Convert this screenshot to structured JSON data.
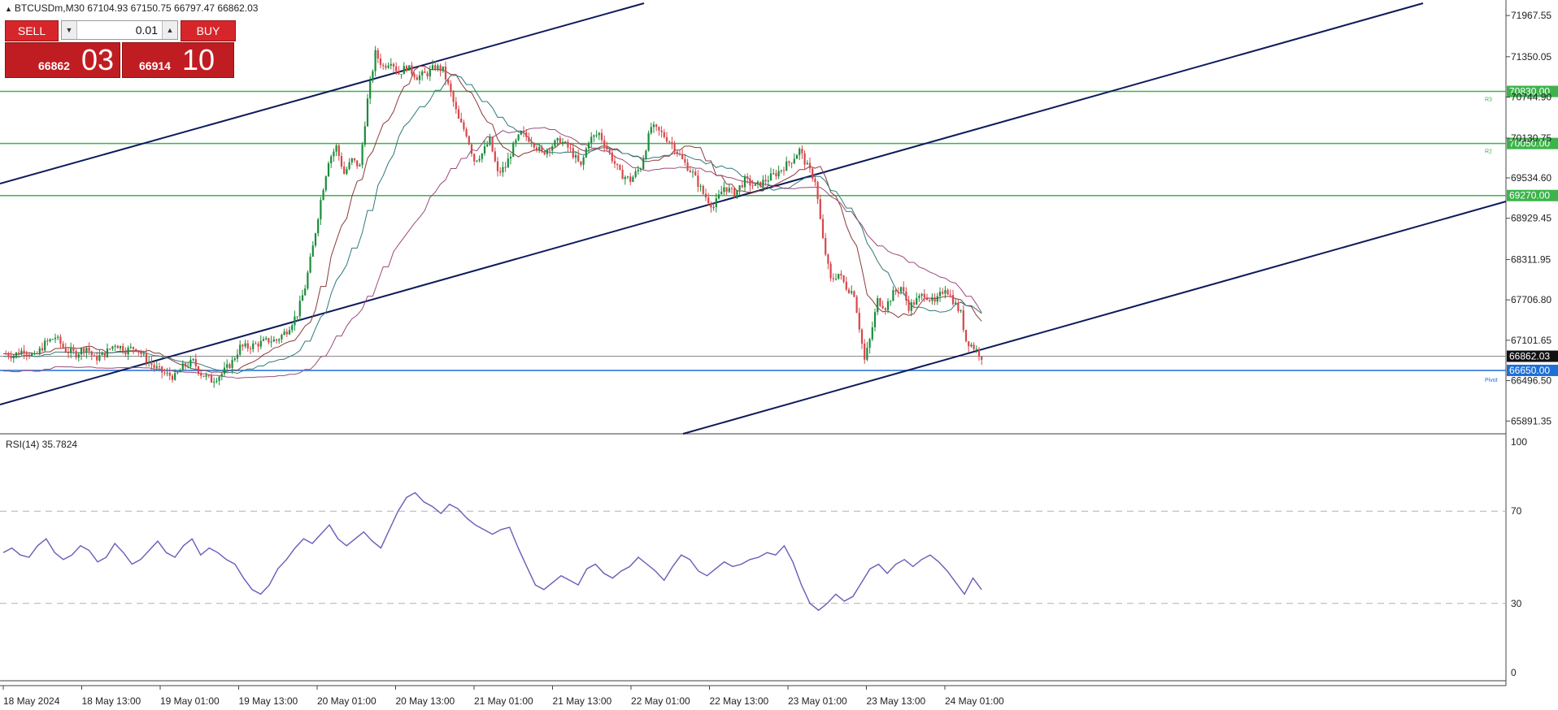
{
  "header": {
    "symbol_info": "BTCUSDm,M30  67104.93 67150.75 66797.47 66862.03"
  },
  "trade_panel": {
    "sell_label": "SELL",
    "buy_label": "BUY",
    "lot_value": "0.01",
    "sell_price_small": "66862",
    "sell_price_big": "03",
    "buy_price_small": "66914",
    "buy_price_big": "10"
  },
  "chart_data": {
    "type": "candlestick",
    "symbol": "BTCUSDm",
    "timeframe": "M30",
    "ohlc": {
      "open": 67104.93,
      "high": 67150.75,
      "low": 66797.47,
      "close": 66862.03
    },
    "price_axis_ticks": [
      "71967.55",
      "71350.05",
      "70744.90",
      "70130.75",
      "69534.60",
      "68929.45",
      "68311.95",
      "67706.80",
      "67101.65",
      "66496.50",
      "65891.35"
    ],
    "time_axis_ticks": [
      "18 May 2024",
      "18 May 13:00",
      "19 May 01:00",
      "19 May 13:00",
      "20 May 01:00",
      "20 May 13:00",
      "21 May 01:00",
      "21 May 13:00",
      "22 May 01:00",
      "22 May 13:00",
      "23 May 01:00",
      "23 May 13:00",
      "24 May 01:00"
    ],
    "current_price": "66862.03",
    "horizontal_levels": [
      {
        "label": "70830.00",
        "value": 70830.0,
        "color": "#3cb44b",
        "tag": "R3"
      },
      {
        "label": "70050.00",
        "value": 70050.0,
        "color": "#3cb44b",
        "tag": "R2"
      },
      {
        "label": "69270.00",
        "value": 69270.0,
        "color": "#3cb44b",
        "tag": ""
      },
      {
        "label": "66650.00",
        "value": 66650.0,
        "color": "#1e6fd6",
        "tag": "Pivot"
      }
    ],
    "price_path": [
      [
        0,
        66900
      ],
      [
        8,
        66880
      ],
      [
        16,
        66960
      ],
      [
        24,
        66850
      ],
      [
        32,
        67050
      ],
      [
        40,
        67150
      ],
      [
        48,
        66950
      ],
      [
        56,
        66900
      ],
      [
        64,
        67000
      ],
      [
        70,
        66820
      ],
      [
        78,
        66900
      ],
      [
        86,
        67050
      ],
      [
        94,
        66950
      ],
      [
        102,
        67000
      ],
      [
        108,
        66850
      ],
      [
        116,
        66700
      ],
      [
        124,
        66600
      ],
      [
        132,
        66550
      ],
      [
        138,
        66700
      ],
      [
        146,
        66780
      ],
      [
        152,
        66600
      ],
      [
        160,
        66500
      ],
      [
        168,
        66600
      ],
      [
        176,
        66780
      ],
      [
        182,
        67000
      ],
      [
        188,
        67000
      ],
      [
        196,
        67050
      ],
      [
        204,
        67100
      ],
      [
        210,
        67100
      ],
      [
        218,
        67250
      ],
      [
        226,
        67500
      ],
      [
        232,
        67900
      ],
      [
        238,
        68500
      ],
      [
        244,
        69200
      ],
      [
        250,
        69800
      ],
      [
        256,
        70000
      ],
      [
        262,
        69600
      ],
      [
        268,
        69800
      ],
      [
        274,
        69700
      ],
      [
        280,
        70700
      ],
      [
        286,
        71400
      ],
      [
        292,
        71200
      ],
      [
        298,
        71300
      ],
      [
        304,
        71100
      ],
      [
        310,
        71200
      ],
      [
        318,
        71050
      ],
      [
        326,
        71100
      ],
      [
        332,
        71200
      ],
      [
        338,
        71150
      ],
      [
        344,
        70800
      ],
      [
        350,
        70400
      ],
      [
        356,
        70200
      ],
      [
        362,
        69800
      ],
      [
        368,
        69900
      ],
      [
        374,
        70100
      ],
      [
        380,
        69600
      ],
      [
        386,
        69700
      ],
      [
        392,
        70000
      ],
      [
        398,
        70200
      ],
      [
        406,
        70100
      ],
      [
        414,
        69900
      ],
      [
        420,
        70000
      ],
      [
        428,
        70100
      ],
      [
        436,
        69950
      ],
      [
        444,
        69700
      ],
      [
        450,
        70100
      ],
      [
        458,
        70200
      ],
      [
        466,
        69900
      ],
      [
        474,
        69600
      ],
      [
        482,
        69500
      ],
      [
        490,
        69700
      ],
      [
        498,
        70300
      ],
      [
        506,
        70200
      ],
      [
        514,
        70050
      ],
      [
        522,
        69800
      ],
      [
        530,
        69600
      ],
      [
        538,
        69300
      ],
      [
        546,
        69100
      ],
      [
        554,
        69400
      ],
      [
        562,
        69300
      ],
      [
        570,
        69500
      ],
      [
        578,
        69400
      ],
      [
        586,
        69500
      ],
      [
        594,
        69600
      ],
      [
        600,
        69700
      ],
      [
        606,
        69800
      ],
      [
        612,
        69950
      ],
      [
        618,
        69700
      ],
      [
        624,
        69500
      ],
      [
        630,
        68600
      ],
      [
        636,
        68000
      ],
      [
        642,
        68100
      ],
      [
        648,
        67900
      ],
      [
        654,
        67800
      ],
      [
        658,
        67300
      ],
      [
        662,
        66800
      ],
      [
        666,
        67100
      ],
      [
        672,
        67700
      ],
      [
        678,
        67600
      ],
      [
        684,
        67800
      ],
      [
        690,
        67900
      ],
      [
        696,
        67600
      ],
      [
        702,
        67700
      ],
      [
        708,
        67800
      ],
      [
        716,
        67650
      ],
      [
        724,
        67900
      ],
      [
        730,
        67700
      ],
      [
        736,
        67500
      ],
      [
        740,
        67100
      ],
      [
        746,
        67000
      ],
      [
        752,
        66860
      ]
    ],
    "rsi": {
      "label": "RSI(14) 35.7824",
      "period": 14,
      "value": 35.7824,
      "levels": [
        70,
        30
      ],
      "axis_ticks": [
        "100",
        "70",
        "30",
        "0"
      ],
      "values": [
        52,
        54,
        51,
        50,
        55,
        58,
        52,
        49,
        51,
        55,
        53,
        48,
        50,
        56,
        52,
        47,
        49,
        53,
        57,
        52,
        50,
        55,
        58,
        51,
        54,
        52,
        49,
        47,
        41,
        36,
        34,
        38,
        45,
        49,
        54,
        58,
        56,
        60,
        64,
        58,
        55,
        58,
        61,
        57,
        54,
        62,
        70,
        76,
        78,
        74,
        72,
        69,
        73,
        71,
        67,
        64,
        62,
        60,
        62,
        63,
        54,
        46,
        38,
        36,
        39,
        42,
        40,
        38,
        45,
        47,
        43,
        41,
        44,
        46,
        50,
        47,
        44,
        40,
        46,
        51,
        49,
        44,
        42,
        45,
        48,
        46,
        47,
        49,
        50,
        52,
        51,
        55,
        48,
        38,
        30,
        27,
        30,
        34,
        31,
        33,
        39,
        45,
        47,
        43,
        47,
        49,
        46,
        49,
        51,
        48,
        44,
        39,
        34,
        41,
        36
      ]
    },
    "channel_lines": 3,
    "moving_averages": 4
  }
}
